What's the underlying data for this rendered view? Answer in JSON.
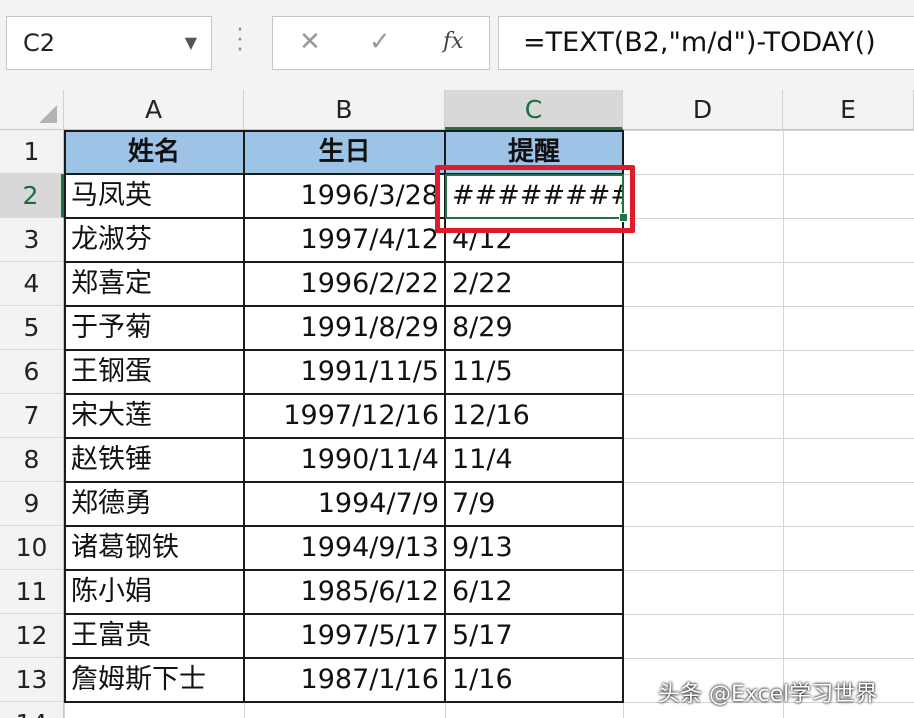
{
  "formula_bar": {
    "name_box": "C2",
    "cancel_icon": "✕",
    "enter_icon": "✓",
    "fx_label": "fx",
    "formula": "=TEXT(B2,\"m/d\")-TODAY()"
  },
  "columns": [
    "A",
    "B",
    "C",
    "D",
    "E"
  ],
  "selected_column": "C",
  "rows": [
    "1",
    "2",
    "3",
    "4",
    "5",
    "6",
    "7",
    "8",
    "9",
    "10",
    "11",
    "12",
    "13",
    "14"
  ],
  "selected_row": "2",
  "table": {
    "headers": [
      "姓名",
      "生日",
      "提醒"
    ],
    "header_color": "#9dc3e6",
    "data": [
      [
        "马凤英",
        "1996/3/28",
        "########"
      ],
      [
        "龙淑芬",
        "1997/4/12",
        "4/12"
      ],
      [
        "郑喜定",
        "1996/2/22",
        "2/22"
      ],
      [
        "于予菊",
        "1991/8/29",
        "8/29"
      ],
      [
        "王钢蛋",
        "1991/11/5",
        "11/5"
      ],
      [
        "宋大莲",
        "1997/12/16",
        "12/16"
      ],
      [
        "赵铁锤",
        "1990/11/4",
        "11/4"
      ],
      [
        "郑德勇",
        "1994/7/9",
        "7/9"
      ],
      [
        "诸葛钢铁",
        "1994/9/13",
        "9/13"
      ],
      [
        "陈小娟",
        "1985/6/12",
        "6/12"
      ],
      [
        "王富贵",
        "1997/5/17",
        "5/17"
      ],
      [
        "詹姆斯下士",
        "1987/1/16",
        "1/16"
      ]
    ]
  },
  "active_cell": "C2",
  "highlight_color": "#e01b2a",
  "accent_color": "#217346",
  "watermark": "头条 @Excel学习世界"
}
